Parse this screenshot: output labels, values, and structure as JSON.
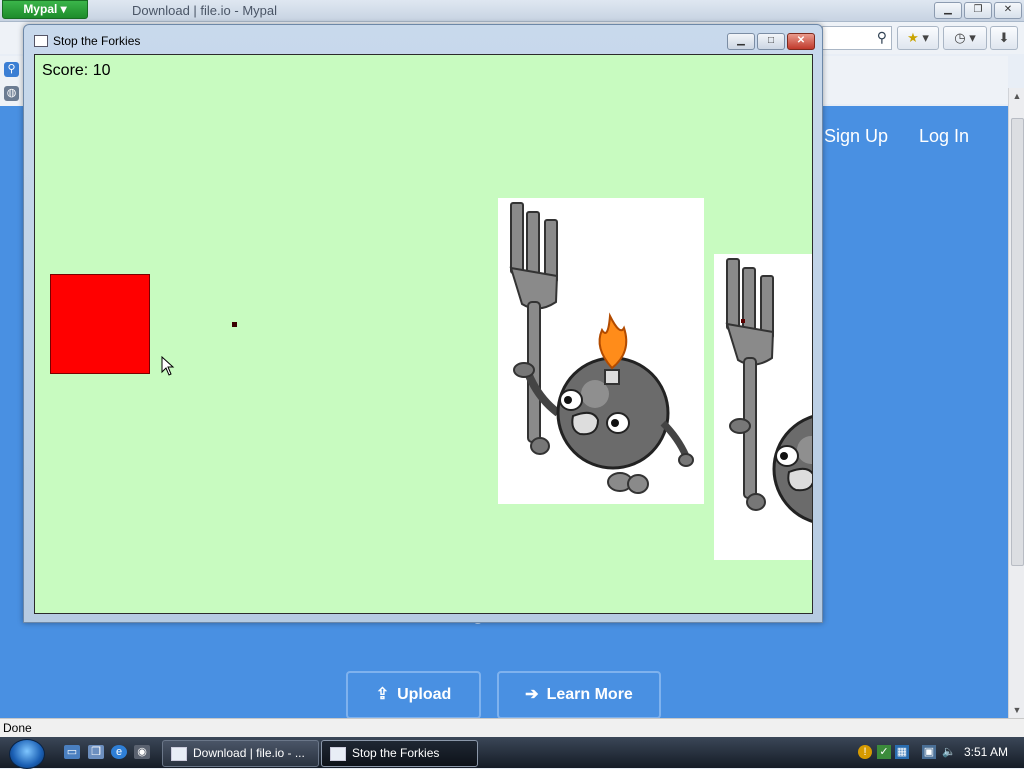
{
  "browser": {
    "app_menu_label": "Mypal",
    "window_title": "Download | file.io - Mypal",
    "controls": {
      "minimize": "▁",
      "maximize": "❐",
      "close": "✕"
    }
  },
  "page": {
    "nav": {
      "sign_up": "Sign Up",
      "log_in": "Log In"
    },
    "buttons": {
      "upload": "Upload",
      "learn_more": "Learn More"
    },
    "icons": {
      "upload": "upload-icon",
      "learn_more": "arrow-right-icon"
    }
  },
  "status_bar": {
    "text": "Done"
  },
  "game_window": {
    "title": "Stop the Forkies",
    "controls": {
      "minimize": "▁",
      "maximize": "□",
      "close": "✕"
    },
    "score_label": "Score: 10",
    "colors": {
      "background": "#c8fbc0",
      "player": "#ff0000",
      "bullet": "#3a0000"
    }
  },
  "taskbar": {
    "tasks": [
      {
        "label": "Download | file.io - ..."
      },
      {
        "label": "Stop the Forkies"
      }
    ],
    "clock": "3:51 AM"
  }
}
